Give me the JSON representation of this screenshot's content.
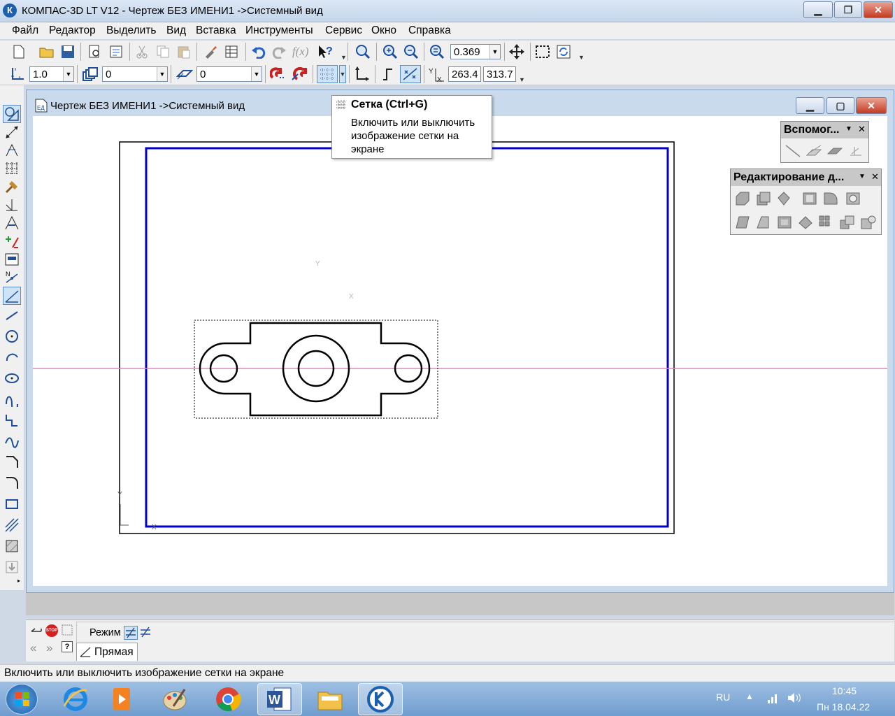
{
  "window": {
    "title": "КОМПАС-3D LT V12 - Чертеж БЕЗ ИМЕНИ1 ->Системный вид"
  },
  "menu": [
    "Файл",
    "Редактор",
    "Выделить",
    "Вид",
    "Вставка",
    "Инструменты",
    "Сервис",
    "Окно",
    "Справка"
  ],
  "toolbar": {
    "zoom_value": "0.369",
    "style_value": "1.0",
    "layer_value": "0",
    "state_value": "0",
    "coord_x": "263.4",
    "coord_y": "313.7"
  },
  "document": {
    "title": "Чертеж БЕЗ ИМЕНИ1 ->Системный вид"
  },
  "tooltip": {
    "title": "Сетка (Ctrl+G)",
    "body": "Включить или выключить изображение сетки на экране"
  },
  "panels": {
    "aux": {
      "title": "Вспомог..."
    },
    "edit": {
      "title": "Редактирование д..."
    }
  },
  "canvas_marks": {
    "y1": "Y",
    "x1": "X",
    "y2": "Y",
    "x2": "X"
  },
  "props": {
    "mode_label": "Режим",
    "tab_label": "Прямая",
    "stop_label": "STOP"
  },
  "status": {
    "text": "Включить или выключить изображение сетки на экране"
  },
  "tray": {
    "lang": "RU",
    "time": "10:45",
    "date": "Пн 18.04.22"
  },
  "app_icon": "К",
  "colors": {
    "frame_blue": "#0000c8",
    "axis_pink": "#d98cb3",
    "tooltip_bg": "#ffffff",
    "taskbar": "#6f9ccf"
  }
}
